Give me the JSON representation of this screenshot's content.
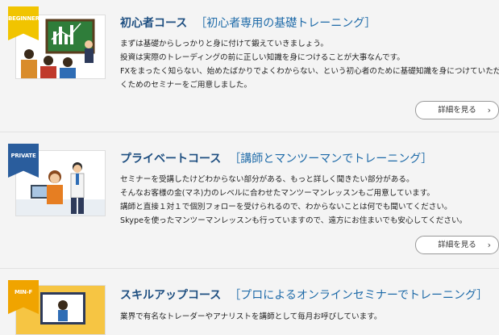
{
  "courses": [
    {
      "badge": "BEGINNER",
      "title": "初心者コース",
      "subtitle": "［初心者専用の基礎トレーニング］",
      "lines": [
        "まずは基礎からしっかりと身に付けて鍛えていきましょう。",
        "投資は実際のトレーディングの前に正しい知識を身につけることが大事なんです。",
        "FXをまったく知らない、始めたばかりでよくわからない、という初心者のために基礎知識を身につけていただ",
        "くためのセミナーをご用意しました。"
      ],
      "button": "詳細を見る"
    },
    {
      "badge": "PRIVATE",
      "title": "プライベートコース",
      "subtitle": "［講師とマンツーマンでトレーニング］",
      "lines": [
        "セミナーを受講したけどわからない部分がある、もっと詳しく聞きたい部分がある。",
        "そんなお客様の金(マネ)力のレベルに合わせたマンツーマンレッスンもご用意しています。",
        "講師と直接１対１で個別フォローを受けられるので、わからないことは何でも聞いてください。",
        "Skypeを使ったマンツーマンレッスンも行っていますので、遠方にお住まいでも安心してください。"
      ],
      "button": "詳細を見る"
    },
    {
      "badge": "MIN-F",
      "title": "スキルアップコース",
      "subtitle": "［プロによるオンラインセミナーでトレーニング］",
      "lines": [
        "業界で有名なトレーダーやアナリストを講師として毎月お呼びしています。"
      ]
    }
  ],
  "colors": {
    "title": "#1d4e80",
    "beginner_ribbon": "#f1c400",
    "private_ribbon": "#2a5d9d",
    "skill_ribbon": "#f0a400"
  }
}
